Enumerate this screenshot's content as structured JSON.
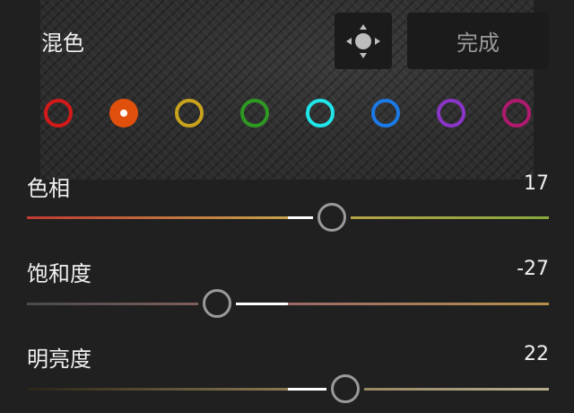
{
  "panel": {
    "title": "混色",
    "done_label": "完成",
    "target_icon": "targeted-adjustment-icon"
  },
  "color_swatches": [
    {
      "name": "red",
      "color": "#d21a1a",
      "selected": false
    },
    {
      "name": "orange",
      "color": "#e0500c",
      "selected": true
    },
    {
      "name": "yellow",
      "color": "#c8a21c",
      "selected": false
    },
    {
      "name": "green",
      "color": "#2e9a22",
      "selected": false
    },
    {
      "name": "aqua",
      "color": "#20e6ea",
      "selected": false
    },
    {
      "name": "blue",
      "color": "#1a7ae6",
      "selected": false
    },
    {
      "name": "purple",
      "color": "#8a34c8",
      "selected": false
    },
    {
      "name": "magenta",
      "color": "#b01a6e",
      "selected": false
    }
  ],
  "sliders": [
    {
      "label": "色相",
      "value_text": "17",
      "value": 17,
      "min": -100,
      "max": 100,
      "track_colors": [
        "#c03a32",
        "#c4a24a",
        "#86a83c"
      ]
    },
    {
      "label": "饱和度",
      "value_text": "-27",
      "value": -27,
      "min": -100,
      "max": 100,
      "track_colors": [
        "#4a4a4a",
        "#9a6a68",
        "#b4904a"
      ]
    },
    {
      "label": "明亮度",
      "value_text": "22",
      "value": 22,
      "min": -100,
      "max": 100,
      "track_colors": [
        "#2a2418",
        "#8a7a52",
        "#b8ad8e"
      ]
    }
  ]
}
